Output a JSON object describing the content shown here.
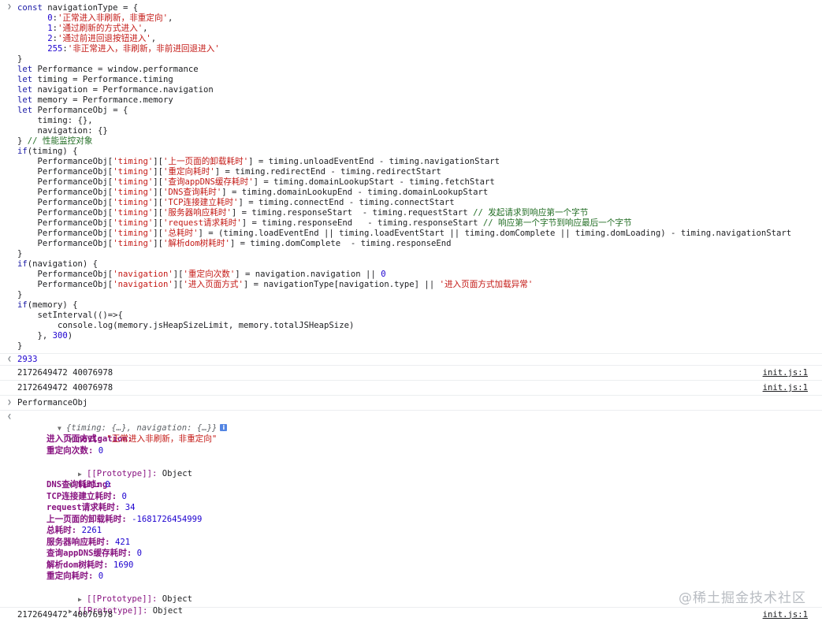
{
  "code_lines": [
    [
      [
        "k",
        "const"
      ],
      [
        "p",
        " navigationType = {"
      ]
    ],
    [
      [
        "p",
        "      "
      ],
      [
        "n",
        "0"
      ],
      [
        "p",
        ":"
      ],
      [
        "s",
        "'正常进入非刷新，非重定向'"
      ],
      [
        "p",
        ","
      ]
    ],
    [
      [
        "p",
        "      "
      ],
      [
        "n",
        "1"
      ],
      [
        "p",
        ":"
      ],
      [
        "s",
        "'通过刷新的方式进入'"
      ],
      [
        "p",
        ","
      ]
    ],
    [
      [
        "p",
        "      "
      ],
      [
        "n",
        "2"
      ],
      [
        "p",
        ":"
      ],
      [
        "s",
        "'通过前进回退按钮进入'"
      ],
      [
        "p",
        ","
      ]
    ],
    [
      [
        "p",
        "      "
      ],
      [
        "n",
        "255"
      ],
      [
        "p",
        ":"
      ],
      [
        "s",
        "'非正常进入，非刷新，非前进回退进入'"
      ]
    ],
    [
      [
        "p",
        "}"
      ]
    ],
    [
      [
        "k",
        "let"
      ],
      [
        "p",
        " Performance = window.performance"
      ]
    ],
    [
      [
        "k",
        "let"
      ],
      [
        "p",
        " timing = Performance.timing"
      ]
    ],
    [
      [
        "k",
        "let"
      ],
      [
        "p",
        " navigation = Performance.navigation"
      ]
    ],
    [
      [
        "k",
        "let"
      ],
      [
        "p",
        " memory = Performance.memory"
      ]
    ],
    [
      [
        "k",
        "let"
      ],
      [
        "p",
        " PerformanceObj = {"
      ]
    ],
    [
      [
        "p",
        "    timing: {},"
      ]
    ],
    [
      [
        "p",
        "    navigation: {}"
      ]
    ],
    [
      [
        "p",
        "} "
      ],
      [
        "c",
        "// 性能监控对象"
      ]
    ],
    [
      [
        "k",
        "if"
      ],
      [
        "p",
        "(timing) {"
      ]
    ],
    [
      [
        "p",
        "    PerformanceObj["
      ],
      [
        "s",
        "'timing'"
      ],
      [
        "p",
        "]["
      ],
      [
        "s",
        "'上一页面的卸载耗时'"
      ],
      [
        "p",
        "] = timing.unloadEventEnd - timing.navigationStart"
      ]
    ],
    [
      [
        "p",
        "    PerformanceObj["
      ],
      [
        "s",
        "'timing'"
      ],
      [
        "p",
        "]["
      ],
      [
        "s",
        "'重定向耗时'"
      ],
      [
        "p",
        "] = timing.redirectEnd - timing.redirectStart"
      ]
    ],
    [
      [
        "p",
        "    PerformanceObj["
      ],
      [
        "s",
        "'timing'"
      ],
      [
        "p",
        "]["
      ],
      [
        "s",
        "'查询appDNS缓存耗时'"
      ],
      [
        "p",
        "] = timing.domainLookupStart - timing.fetchStart"
      ]
    ],
    [
      [
        "p",
        "    PerformanceObj["
      ],
      [
        "s",
        "'timing'"
      ],
      [
        "p",
        "]["
      ],
      [
        "s",
        "'DNS查询耗时'"
      ],
      [
        "p",
        "] = timing.domainLookupEnd - timing.domainLookupStart"
      ]
    ],
    [
      [
        "p",
        "    PerformanceObj["
      ],
      [
        "s",
        "'timing'"
      ],
      [
        "p",
        "]["
      ],
      [
        "s",
        "'TCP连接建立耗时'"
      ],
      [
        "p",
        "] = timing.connectEnd - timing.connectStart"
      ]
    ],
    [
      [
        "p",
        "    PerformanceObj["
      ],
      [
        "s",
        "'timing'"
      ],
      [
        "p",
        "]["
      ],
      [
        "s",
        "'服务器响应耗时'"
      ],
      [
        "p",
        "] = timing.responseStart  - timing.requestStart "
      ],
      [
        "c",
        "// 发起请求到响应第一个字节"
      ]
    ],
    [
      [
        "p",
        "    PerformanceObj["
      ],
      [
        "s",
        "'timing'"
      ],
      [
        "p",
        "]["
      ],
      [
        "s",
        "'request请求耗时'"
      ],
      [
        "p",
        "] = timing.responseEnd   - timing.responseStart "
      ],
      [
        "c",
        "// 响应第一个字节到响应最后一个字节"
      ]
    ],
    [
      [
        "p",
        "    PerformanceObj["
      ],
      [
        "s",
        "'timing'"
      ],
      [
        "p",
        "]["
      ],
      [
        "s",
        "'总耗时'"
      ],
      [
        "p",
        "] = (timing.loadEventEnd || timing.loadEventStart || timing.domComplete || timing.domLoading) - timing.navigationStart"
      ]
    ],
    [
      [
        "p",
        "    PerformanceObj["
      ],
      [
        "s",
        "'timing'"
      ],
      [
        "p",
        "]["
      ],
      [
        "s",
        "'解析dom树耗时'"
      ],
      [
        "p",
        "] = timing.domComplete  - timing.responseEnd"
      ]
    ],
    [
      [
        "p",
        "}"
      ]
    ],
    [
      [
        "k",
        "if"
      ],
      [
        "p",
        "(navigation) {"
      ]
    ],
    [
      [
        "p",
        "    PerformanceObj["
      ],
      [
        "s",
        "'navigation'"
      ],
      [
        "p",
        "]["
      ],
      [
        "s",
        "'重定向次数'"
      ],
      [
        "p",
        "] = navigation.navigation || "
      ],
      [
        "n",
        "0"
      ]
    ],
    [
      [
        "p",
        "    PerformanceObj["
      ],
      [
        "s",
        "'navigation'"
      ],
      [
        "p",
        "]["
      ],
      [
        "s",
        "'进入页面方式'"
      ],
      [
        "p",
        "] = navigationType[navigation.type] || "
      ],
      [
        "s",
        "'进入页面方式加载异常'"
      ]
    ],
    [
      [
        "p",
        "}"
      ]
    ],
    [
      [
        "k",
        "if"
      ],
      [
        "p",
        "(memory) {"
      ]
    ],
    [
      [
        "p",
        "    setInterval(()=>{"
      ]
    ],
    [
      [
        "p",
        "        console.log(memory.jsHeapSizeLimit, memory.totalJSHeapSize)"
      ]
    ],
    [
      [
        "p",
        "    }, "
      ],
      [
        "n",
        "300"
      ],
      [
        "p",
        ")"
      ]
    ],
    [
      [
        "p",
        "}"
      ]
    ]
  ],
  "result1": "2933",
  "log_value": "2172649472 40076978",
  "log_link": "init.js:1",
  "input2": "PerformanceObj",
  "obj_preview": "{timing: {…}, navigation: {…}}",
  "info_glyph": "i",
  "nav_key": "navigation:",
  "nav_props": [
    {
      "k": "进入页面方式:",
      "v": "\"正常进入非刷新，非重定向\"",
      "t": "s"
    },
    {
      "k": "重定向次数:",
      "v": "0",
      "t": "n"
    }
  ],
  "proto_label": "[[Prototype]]:",
  "proto_value": "Object",
  "timing_key": "timing:",
  "timing_props": [
    {
      "k": "DNS查询耗时:",
      "v": "0"
    },
    {
      "k": "TCP连接建立耗时:",
      "v": "0"
    },
    {
      "k": "request请求耗时:",
      "v": "34"
    },
    {
      "k": "上一页面的卸载耗时:",
      "v": "-1681726454999"
    },
    {
      "k": "总耗时:",
      "v": "2261"
    },
    {
      "k": "服务器响应耗时:",
      "v": "421"
    },
    {
      "k": "查询appDNS缓存耗时:",
      "v": "0"
    },
    {
      "k": "解析dom树耗时:",
      "v": "1690"
    },
    {
      "k": "重定向耗时:",
      "v": "0"
    }
  ],
  "watermark": "@稀土掘金技术社区",
  "icons": {
    "prompt": "chevron-right-icon",
    "result": "chevron-left-icon",
    "expanded": "triangle-down-icon",
    "collapsed": "triangle-right-icon"
  }
}
